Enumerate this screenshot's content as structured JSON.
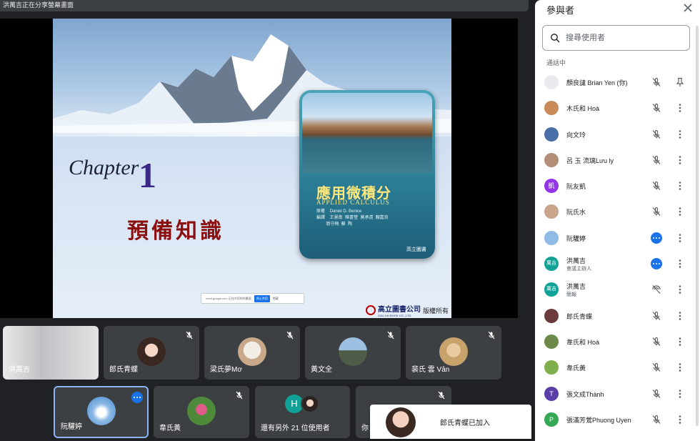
{
  "banner": {
    "text": "洪萬吉正在分享螢幕畫面"
  },
  "slide": {
    "chapter_word": "Chapter",
    "chapter_number": "1",
    "chapter_title": "預備知識",
    "book_title": "應用微積分",
    "book_subtitle": "APPLIED CALCULUS",
    "book_author": "原著    Daniel D. Benice\n編譯    王景南  陳書瑩  莫承遠  顏嘉良\n        翁守梅  蘇  陶",
    "book_publisher": "高立圖書",
    "notice_text": "meet.google.com 正在共用你的畫面",
    "notice_stop": "停止共用",
    "notice_hide": "隱藏",
    "footer_company": "高立圖書公司",
    "footer_company_en": "GAU LIH BOOK CO., LTD.",
    "footer_rights": "版權所有"
  },
  "tiles": [
    {
      "name": "洪萬吉",
      "muted": false
    },
    {
      "name": "郎氏青蝶",
      "muted": true
    },
    {
      "name": "梁氏夢Mơ",
      "muted": true
    },
    {
      "name": "黃文全",
      "muted": true
    },
    {
      "name": "裴氏 雲 Vân",
      "muted": true
    },
    {
      "name": "阮驩婷",
      "muted": false
    },
    {
      "name": "韋氏黃",
      "muted": true
    },
    {
      "name": "還有另外 21 位使用者",
      "muted": false
    },
    {
      "name": "你",
      "muted": true
    }
  ],
  "others_avatar_letter": "H",
  "toast": {
    "message": "郎氏青蝶已加入"
  },
  "panel": {
    "title": "參與者",
    "search_placeholder": "搜尋使用者",
    "section_label": "通話中",
    "participants": [
      {
        "name": "顏良譴 Brian Yen (你)",
        "sub": "",
        "avatar": "",
        "color": "#e8eaed",
        "state": "muted",
        "action": "pin"
      },
      {
        "name": "木氏和 Hoà",
        "sub": "",
        "avatar": "",
        "color": "#c98a5a",
        "state": "muted",
        "action": "more"
      },
      {
        "name": "向文玲",
        "sub": "",
        "avatar": "",
        "color": "#4a6fa8",
        "state": "muted",
        "action": "more"
      },
      {
        "name": "呂 玉 流璃Lưu ly",
        "sub": "",
        "avatar": "",
        "color": "#b58e7a",
        "state": "muted",
        "action": "more"
      },
      {
        "name": "阮友凱",
        "sub": "",
        "avatar": "凱",
        "color": "#9334e6",
        "state": "muted",
        "action": "more"
      },
      {
        "name": "阮氏水",
        "sub": "",
        "avatar": "",
        "color": "#c9a48a",
        "state": "muted",
        "action": "more"
      },
      {
        "name": "阮驩婷",
        "sub": "",
        "avatar": "",
        "color": "#8fbbe6",
        "state": "speaking",
        "action": "more"
      },
      {
        "name": "洪萬吉",
        "sub": "會議主辦人",
        "avatar": "萬吉",
        "color": "#12a196",
        "state": "speaking",
        "action": "more"
      },
      {
        "name": "洪萬吉",
        "sub": "簡報",
        "avatar": "萬吉",
        "color": "#12a196",
        "state": "presenting",
        "action": "more"
      },
      {
        "name": "郎氏青蝶",
        "sub": "",
        "avatar": "",
        "color": "#6b3b3b",
        "state": "muted",
        "action": "more"
      },
      {
        "name": "韋氏和 Hoà",
        "sub": "",
        "avatar": "",
        "color": "#6e8a4a",
        "state": "muted",
        "action": "more"
      },
      {
        "name": "韋氏黃",
        "sub": "",
        "avatar": "",
        "color": "#7fae4c",
        "state": "muted",
        "action": "more"
      },
      {
        "name": "張文成Thành",
        "sub": "",
        "avatar": "T",
        "color": "#5a3fa8",
        "state": "muted",
        "action": "more"
      },
      {
        "name": "張滿芳鶯Phuong Uyen",
        "sub": "",
        "avatar": "P",
        "color": "#34a853",
        "state": "muted",
        "action": "more"
      }
    ]
  },
  "colors": {
    "panel_bg": "#ffffff",
    "app_bg": "#202124",
    "tile_bg": "#3c4043",
    "accent": "#1a73e8",
    "host_teal": "#12a196"
  }
}
